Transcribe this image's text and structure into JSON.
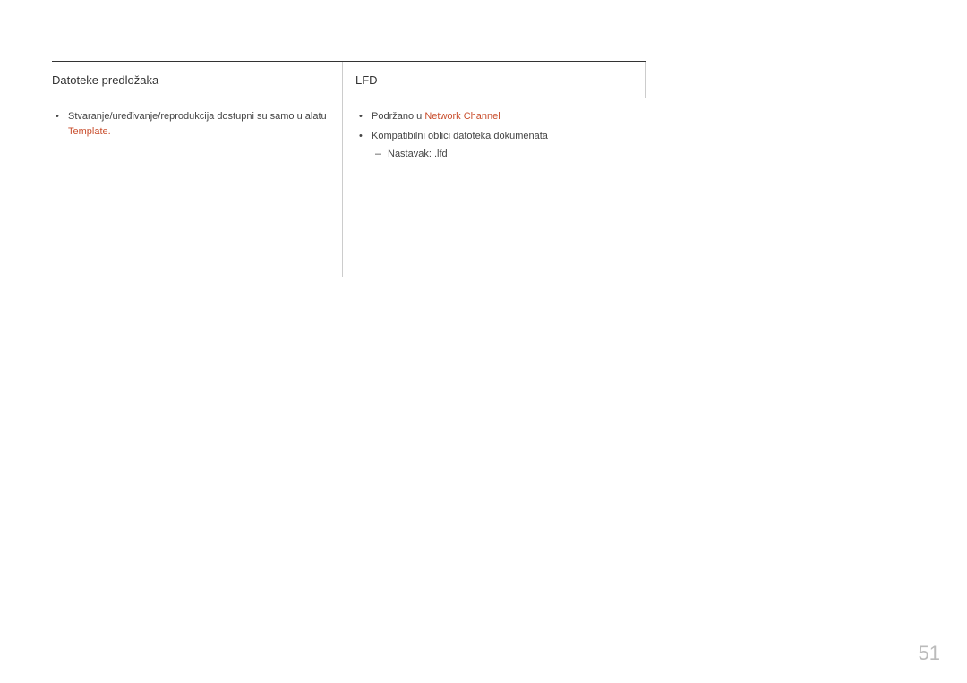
{
  "table": {
    "headerLeft": "Datoteke predložaka",
    "headerRight": "LFD",
    "leftBullet1": {
      "text": "Stvaranje/uređivanje/reprodukcija dostupni su samo u alatu ",
      "highlight": "Template"
    },
    "rightBullet1": {
      "text": "Podržano u ",
      "highlight": "Network Channel"
    },
    "rightBullet2": "Kompatibilni oblici datoteka dokumenata",
    "rightDash1": "Nastavak: .lfd"
  },
  "pageNumber": "51",
  "periodText": "."
}
